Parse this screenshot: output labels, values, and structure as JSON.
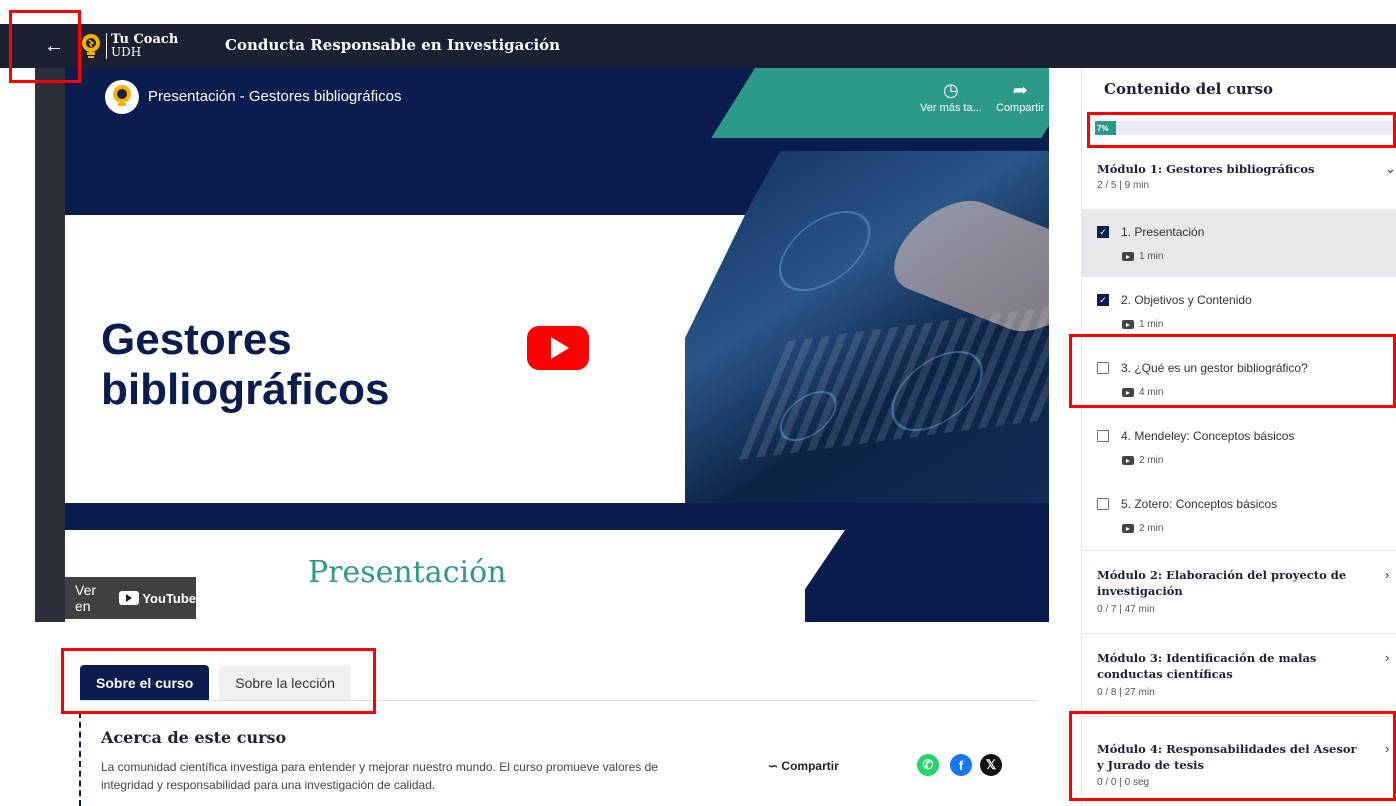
{
  "header": {
    "back_icon": "arrow-left-icon",
    "logo_line1": "Tu Coach",
    "logo_line2": "UDH",
    "course_title": "Conducta Responsable en Investigación"
  },
  "video": {
    "title": "Presentación - Gestores bibliográficos",
    "watch_later_label": "Ver más ta...",
    "share_label": "Compartir",
    "slide_heading_line1": "Gestores",
    "slide_heading_line2": "bibliográficos",
    "slide_subtitle": "Presentación",
    "watch_on_label": "Ver en",
    "youtube_label": "YouTube"
  },
  "tabs": [
    {
      "label": "Sobre el curso",
      "active": true
    },
    {
      "label": "Sobre la lección",
      "active": false
    }
  ],
  "about": {
    "title": "Acerca de este curso",
    "description": "La comunidad científica investiga para entender y mejorar nuestro mundo. El curso promueve valores de integridad y responsabilidad para una investigación de calidad.",
    "share_label": "Compartir"
  },
  "sidebar": {
    "title": "Contenido del curso",
    "progress_label": "7%",
    "progress_fraction": 0.07,
    "modules": [
      {
        "title": "Módulo 1: Gestores bibliográficos",
        "meta": "2 / 5 | 9 min",
        "lessons": [
          {
            "title": "1. Presentación",
            "duration": "1 min",
            "checked": true
          },
          {
            "title": "2. Objetivos y Contenido",
            "duration": "1 min",
            "checked": true
          },
          {
            "title": "3. ¿Qué es un gestor bibliográfico?",
            "duration": "4 min",
            "checked": false
          },
          {
            "title": "4. Mendeley: Conceptos básicos",
            "duration": "2 min",
            "checked": false
          },
          {
            "title": "5. Zotero: Conceptos básicos",
            "duration": "2 min",
            "checked": false
          }
        ]
      },
      {
        "title": "Módulo 2: Elaboración del proyecto de investigación",
        "meta": "0 / 7 | 47 min"
      },
      {
        "title": "Módulo 3: Identificación de malas conductas científicas",
        "meta": "0 / 8 | 27 min"
      },
      {
        "title": "Módulo 4: Responsabilidades del Asesor y Jurado de tesis",
        "meta": "0 / 0 | 0 seg"
      }
    ]
  },
  "colors": {
    "navy": "#0b1d4e",
    "topbar": "#1b2033",
    "teal": "#2c9a88",
    "annotation": "#ff0000"
  }
}
